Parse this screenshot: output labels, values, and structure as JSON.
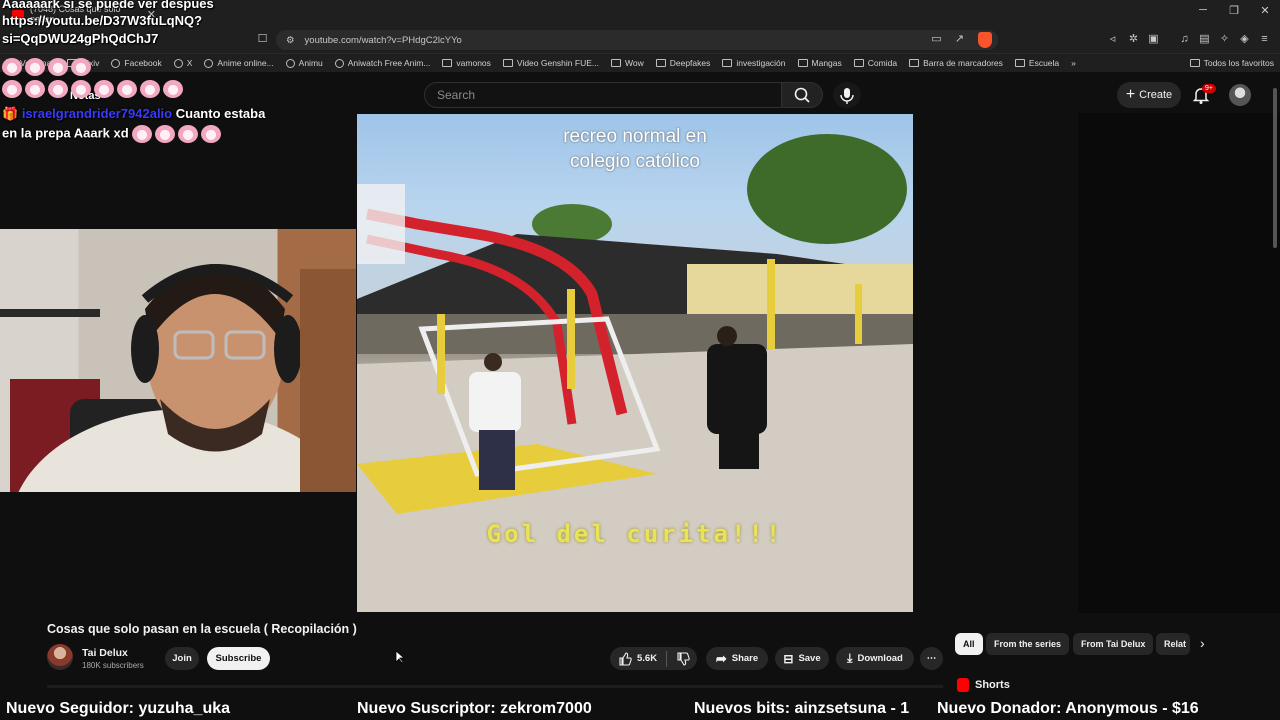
{
  "browser": {
    "tab_title": "(7048) Cosas que solo pasan",
    "url": "youtube.com/watch?v=PHdgC2lcYYo",
    "win_minimize": "─",
    "win_restore": "❐",
    "win_close": "✕"
  },
  "bookmarks": [
    {
      "label": "Ventanas",
      "icon": "folder"
    },
    {
      "label": "Pixiv",
      "icon": "folder"
    },
    {
      "label": "Facebook",
      "icon": "globe"
    },
    {
      "label": "X",
      "icon": "globe"
    },
    {
      "label": "Anime online...",
      "icon": "globe"
    },
    {
      "label": "Animu",
      "icon": "globe"
    },
    {
      "label": "Aniwatch Free Anim...",
      "icon": "globe"
    },
    {
      "label": "vamonos",
      "icon": "folder"
    },
    {
      "label": "Video Genshin FUE...",
      "icon": "folder"
    },
    {
      "label": "Wow",
      "icon": "folder"
    },
    {
      "label": "Deepfakes",
      "icon": "folder"
    },
    {
      "label": "investigación",
      "icon": "folder"
    },
    {
      "label": "Mangas",
      "icon": "folder"
    },
    {
      "label": "Comida",
      "icon": "folder"
    },
    {
      "label": "Barra de marcadores",
      "icon": "folder"
    },
    {
      "label": "Escuela",
      "icon": "folder"
    },
    {
      "label": "Todos los favoritos",
      "icon": "folder"
    }
  ],
  "overlay": {
    "line1": "Aaaaaark si se puede ver despues",
    "line2": "https://youtu.be/D37W3fuLqNQ?",
    "line3": "si=QqDWU24gPhQdChJ7",
    "line4_label": "Notas",
    "gift_user": "israelgrandrider7942alio",
    "chat_text_1": "Cuanto estaba",
    "chat_text_2": "en la prepa Aaark xd"
  },
  "youtube": {
    "search_placeholder": "Search",
    "create_label": "Create",
    "notification_badge": "9+",
    "video_caption_top_1": "recreo normal en",
    "video_caption_top_2": "colegio católico",
    "video_caption_bottom": "Gol del curita!!!",
    "video_title": "Cosas que solo pasan en la escuela ( Recopilación )",
    "channel_name": "Tai Delux",
    "subscribers": "180K subscribers",
    "join_label": "Join",
    "subscribe_label": "Subscribe",
    "likes": "5.6K",
    "share_label": "Share",
    "save_label": "Save",
    "download_label": "Download",
    "more_label": "⋯",
    "chips": [
      "All",
      "From the series",
      "From Tai Delux",
      "Relat"
    ],
    "shorts_label": "Shorts"
  },
  "alerts": {
    "follower": "Nuevo Seguidor: yuzuha_uka",
    "subscriber": "Nuevo Suscriptor: zekrom7000",
    "bits": "Nuevos bits: ainzsetsuna - 1",
    "donor": "Nuevo Donador: Anonymous - $16"
  },
  "colors": {
    "brand_red": "#ff0000",
    "alert_gift_blue": "#3a3aff",
    "caption_yellow": "#e9e356"
  }
}
